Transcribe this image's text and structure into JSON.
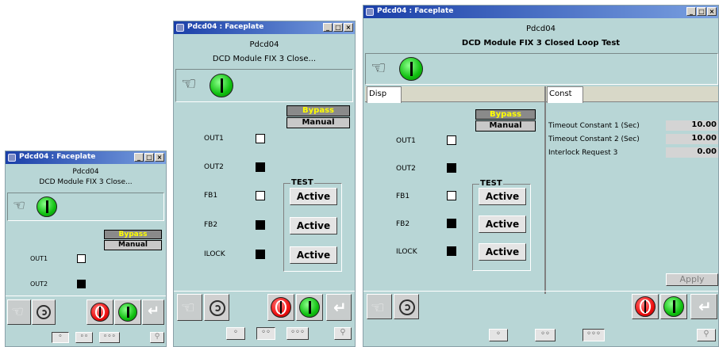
{
  "window": {
    "title": "Pdcd04 : Faceplate",
    "buttons": [
      "_",
      "□",
      "×"
    ],
    "tag": "Pdcd04"
  },
  "win1": {
    "description": "DCD Module FIX 3 Close..."
  },
  "win2": {
    "description": "DCD Module FIX 3 Close..."
  },
  "win3": {
    "description": "DCD Module FIX 3 Closed Loop Test"
  },
  "modes": {
    "bypass": "Bypass",
    "manual": "Manual"
  },
  "signals": {
    "out1": "OUT1",
    "out2": "OUT2",
    "fb1": "FB1",
    "fb2": "FB2",
    "ilock": "ILOCK"
  },
  "test": {
    "label": "TEST",
    "active": "Active"
  },
  "tabs": {
    "disp": "Disp",
    "const": "Const"
  },
  "constants": [
    {
      "label": "Timeout Constant 1 (Sec)",
      "value": "10.00"
    },
    {
      "label": "Timeout Constant 2 (Sec)",
      "value": "10.00"
    },
    {
      "label": "Interlock Request 3",
      "value": "0.00"
    }
  ],
  "apply_label": "Apply",
  "pages": {
    "p1": "◦",
    "p2": "◦◦",
    "p3": "◦◦◦"
  },
  "icons": {
    "hand": "hand-icon",
    "spiral": "spiral-icon",
    "enter": "enter-icon",
    "pin": "pin-icon"
  },
  "colors": {
    "titlebar": "#1a3fa8",
    "body": "#b8d6d6",
    "run": "#10c010",
    "stop": "#ee1010",
    "bypass_text": "#ffff00"
  }
}
